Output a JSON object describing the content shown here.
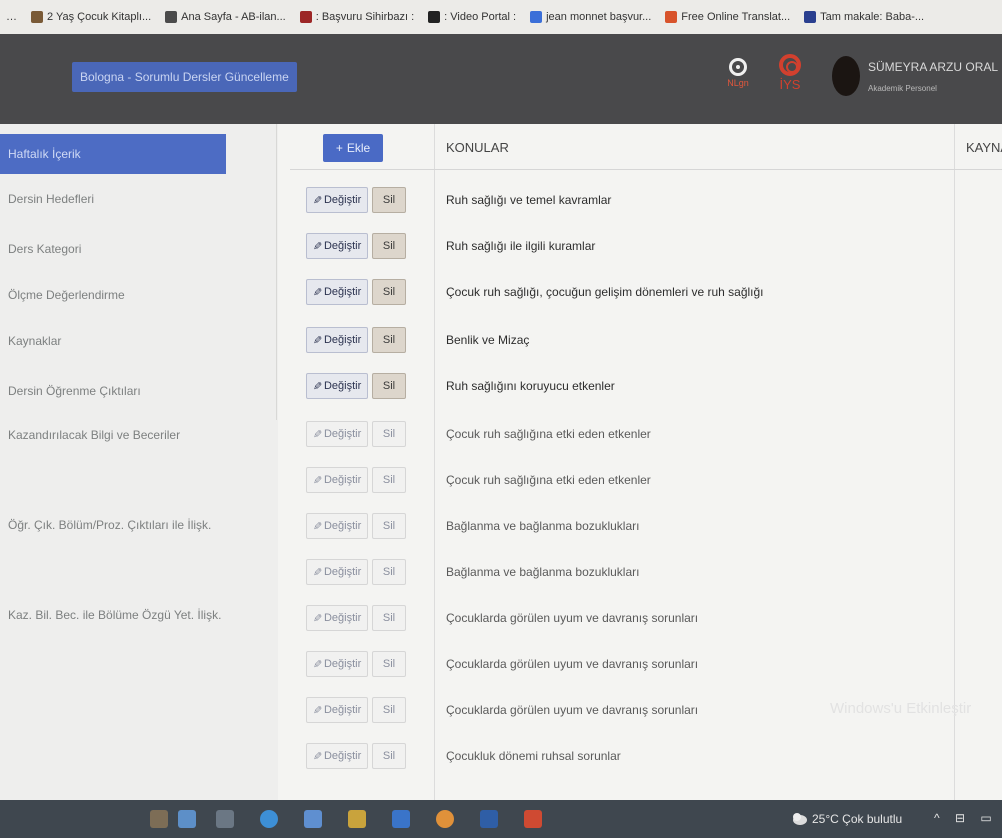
{
  "browser": {
    "bookmarks": [
      {
        "label": "2 Yaş Çocuk Kitaplı...",
        "icon": "book-icon",
        "color": "#7a5a36"
      },
      {
        "label": "Ana Sayfa - AB-ilan...",
        "icon": "dash-icon",
        "color": "#4b4b4b"
      },
      {
        "label": ": Başvuru Sihirbazı :",
        "icon": "heart-icon",
        "color": "#9c2626"
      },
      {
        "label": ": Video Portal :",
        "icon": "globe-icon",
        "color": "#222222"
      },
      {
        "label": "jean monnet başvur...",
        "icon": "google-icon",
        "color": "#3b6fd8"
      },
      {
        "label": "Free Online Translat...",
        "icon": "translate-icon",
        "color": "#d8532b"
      },
      {
        "label": "Tam makale: Baba-...",
        "icon": "article-icon",
        "color": "#2a3f8f"
      }
    ]
  },
  "header": {
    "app_title": "Bologna - Sorumlu Dersler Güncelleme",
    "nlgn_label": "NLgn",
    "iys_label": "İYS",
    "user_name": "SÜMEYRA ARZU ORAL",
    "user_role": "Akademik Personel"
  },
  "sidebar": {
    "items": [
      {
        "label": "Haftalık İçerik",
        "active": true
      },
      {
        "label": "Dersin Hedefleri"
      },
      {
        "label": "Ders Kategori"
      },
      {
        "label": "Ölçme Değerlendirme"
      },
      {
        "label": "Kaynaklar"
      },
      {
        "label": "Dersin Öğrenme Çıktıları"
      },
      {
        "label": "Kazandırılacak Bilgi ve Beceriler"
      },
      {
        "label": "Öğr. Çık. Bölüm/Proz. Çıktıları ile İlişk."
      },
      {
        "label": "Kaz. Bil. Bec. ile Bölüme Özgü Yet. İlişk."
      }
    ]
  },
  "table": {
    "add_label": "Ekle",
    "col_topics": "KONULAR",
    "col_sources": "KAYNA",
    "edit_label": "Değiştir",
    "delete_label": "Sil",
    "rows": [
      "Ruh sağlığı ve temel kavramlar",
      "Ruh sağlığı ile ilgili kuramlar",
      "Çocuk ruh sağlığı, çocuğun gelişim dönemleri ve ruh sağlığı",
      "Benlik ve Mizaç",
      "Ruh sağlığını koruyucu etkenler",
      "Çocuk ruh sağlığına etki eden etkenler",
      "Çocuk ruh sağlığına etki eden etkenler",
      "Bağlanma ve bağlanma bozuklukları",
      "Bağlanma ve bağlanma bozuklukları",
      "Çocuklarda görülen uyum ve davranış sorunları",
      "Çocuklarda görülen uyum ve davranış sorunları",
      "Çocuklarda görülen uyum ve davranış sorunları",
      "Çocukluk dönemi ruhsal sorunlar"
    ]
  },
  "overlay": {
    "watermark": "Windows'u Etkinleştir"
  },
  "taskbar": {
    "weather": "25°C  Çok bulutlu",
    "tray": "^ ⊟ ▭"
  },
  "colors": {
    "accent": "#4a6ac5",
    "header_bg": "#49494b",
    "iys_red": "#d2402e"
  }
}
